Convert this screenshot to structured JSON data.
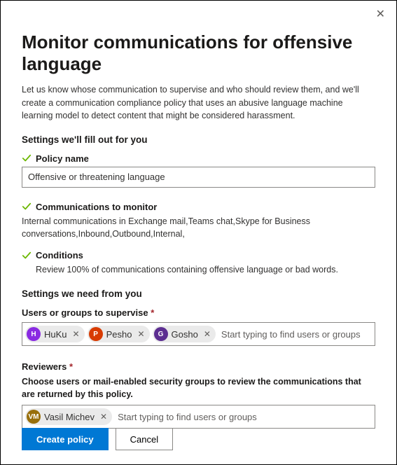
{
  "title": "Monitor communications for offensive language",
  "intro": "Let us know whose communication to supervise and who should review them, and we'll create a communication compliance policy that uses an abusive language machine learning model to detect content that might be considered harassment.",
  "section_prefilled_heading": "Settings we'll fill out for you",
  "policy_name": {
    "label": "Policy name",
    "value": "Offensive or threatening language"
  },
  "comms": {
    "label": "Communications to monitor",
    "description": "Internal communications in Exchange mail,Teams chat,Skype for Business conversations,Inbound,Outbound,Internal,"
  },
  "conditions": {
    "label": "Conditions",
    "description": "Review 100% of communications containing offensive language or bad words."
  },
  "section_need_heading": "Settings we need from you",
  "supervise": {
    "label": "Users or groups to supervise",
    "required_mark": "*",
    "placeholder": "Start typing to find users or groups",
    "chips": [
      {
        "initial": "H",
        "name": "HuKu",
        "avatar_class": "av-purple"
      },
      {
        "initial": "P",
        "name": "Pesho",
        "avatar_class": "av-orange"
      },
      {
        "initial": "G",
        "name": "Gosho",
        "avatar_class": "av-violet"
      }
    ]
  },
  "reviewers": {
    "label": "Reviewers",
    "required_mark": "*",
    "help": "Choose users or mail-enabled security groups to review the communications that are returned by this policy.",
    "placeholder": "Start typing to find users or groups",
    "chips": [
      {
        "initial": "VM",
        "name": "Vasil Michev",
        "avatar_class": "av-olive"
      }
    ]
  },
  "buttons": {
    "primary": "Create policy",
    "secondary": "Cancel"
  }
}
